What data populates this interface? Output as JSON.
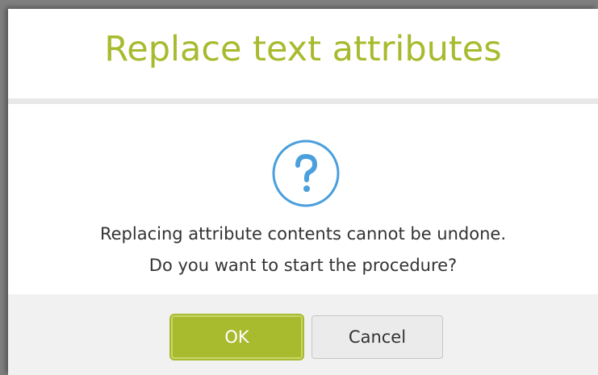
{
  "dialog": {
    "title": "Replace text attributes",
    "icon": "question-icon",
    "message_line1": "Replacing attribute contents cannot be undone.",
    "message_line2": "Do you want to start the procedure?",
    "ok_label": "OK",
    "cancel_label": "Cancel"
  },
  "colors": {
    "accent": "#a8ba2d",
    "icon_blue": "#4a9fdc",
    "footer_bg": "#f1f1f1"
  }
}
